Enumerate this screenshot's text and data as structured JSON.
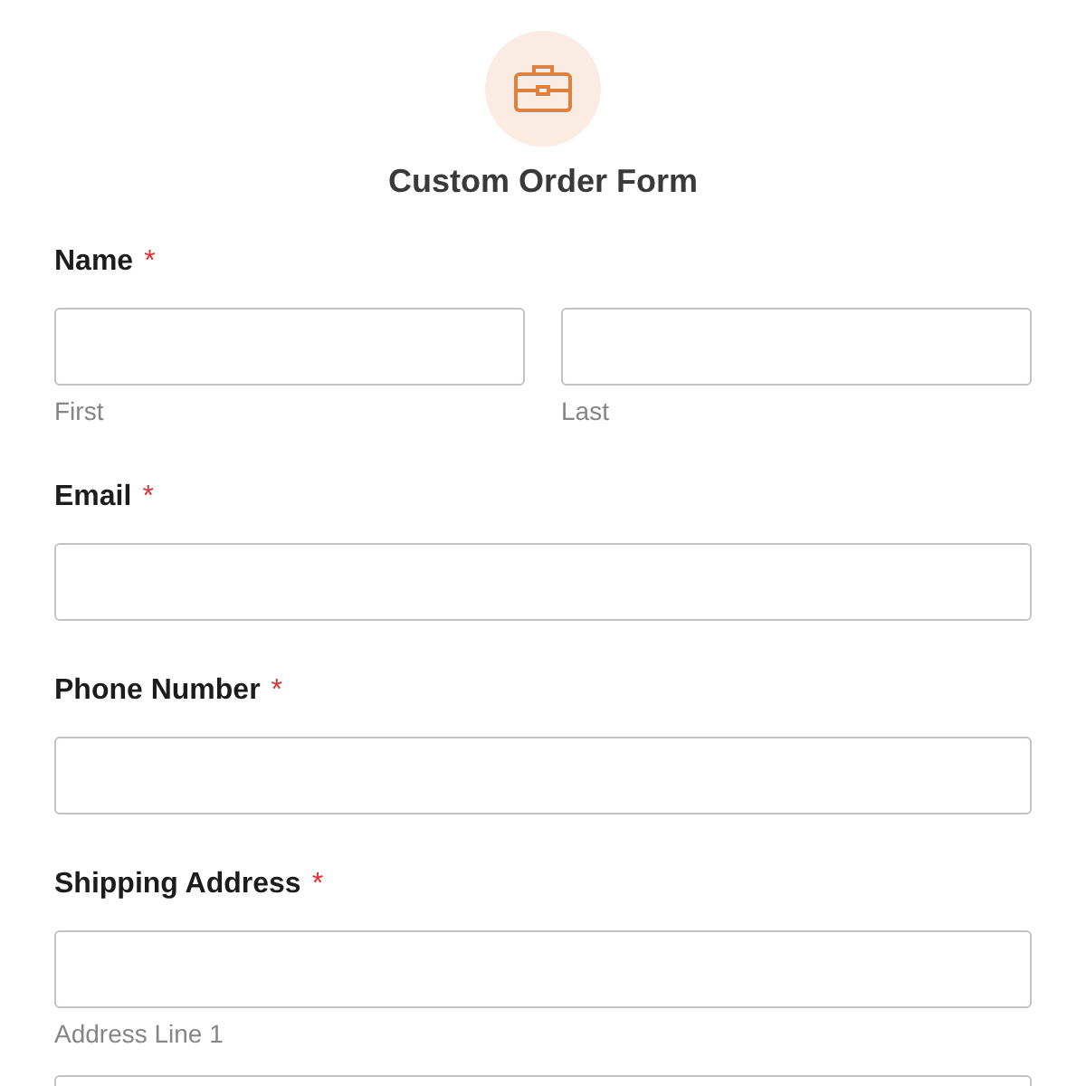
{
  "form": {
    "title": "Custom Order Form"
  },
  "fields": [
    {
      "label": "Name",
      "required_mark": "*",
      "inputs": [
        {
          "kind": "text",
          "sublabel": "First"
        },
        {
          "kind": "text",
          "sublabel": "Last"
        }
      ]
    },
    {
      "label": "Email",
      "required_mark": "*",
      "inputs": [
        {
          "kind": "text"
        }
      ]
    },
    {
      "label": "Phone Number",
      "required_mark": "*",
      "inputs": [
        {
          "kind": "text"
        }
      ]
    },
    {
      "label": "Shipping Address",
      "required_mark": "*",
      "inputs": [
        {
          "kind": "text",
          "sublabel": "Address Line 1"
        },
        {
          "kind": "text"
        }
      ]
    }
  ]
}
